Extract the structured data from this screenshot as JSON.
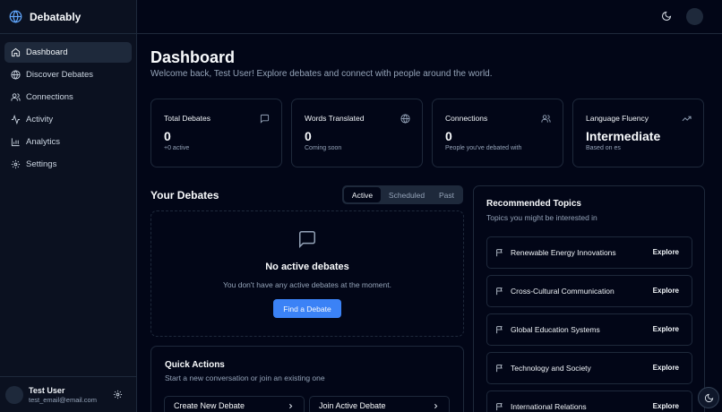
{
  "app": {
    "name": "Debatably"
  },
  "sidebar": {
    "items": [
      {
        "label": "Dashboard"
      },
      {
        "label": "Discover Debates"
      },
      {
        "label": "Connections"
      },
      {
        "label": "Activity"
      },
      {
        "label": "Analytics"
      },
      {
        "label": "Settings"
      }
    ],
    "active_item": "Dashboard"
  },
  "user": {
    "name": "Test User",
    "email": "test_email@email.com"
  },
  "header": {
    "title": "Dashboard",
    "subtitle": "Welcome back, Test User! Explore debates and connect with people around the world."
  },
  "stats": [
    {
      "title": "Total Debates",
      "value": "0",
      "note": "+0 active",
      "icon": "message-square-icon"
    },
    {
      "title": "Words Translated",
      "value": "0",
      "note": "Coming soon",
      "icon": "globe-icon"
    },
    {
      "title": "Connections",
      "value": "0",
      "note": "People you've debated with",
      "icon": "users-icon"
    },
    {
      "title": "Language Fluency",
      "value": "Intermediate",
      "note": "Based on es",
      "icon": "trending-up-icon"
    }
  ],
  "debates": {
    "title": "Your Debates",
    "tabs": [
      {
        "label": "Active"
      },
      {
        "label": "Scheduled"
      },
      {
        "label": "Past"
      }
    ],
    "active_tab": "Active",
    "empty_title": "No active debates",
    "empty_text": "You don't have any active debates at the moment.",
    "find_button": "Find a Debate"
  },
  "quick_actions": {
    "title": "Quick Actions",
    "subtitle": "Start a new conversation or join an existing one",
    "buttons": [
      {
        "label": "Create New Debate"
      },
      {
        "label": "Join Active Debate"
      }
    ]
  },
  "recommended": {
    "title": "Recommended Topics",
    "subtitle": "Topics you might be interested in",
    "topics": [
      {
        "label": "Renewable Energy Innovations",
        "action": "Explore"
      },
      {
        "label": "Cross-Cultural Communication",
        "action": "Explore"
      },
      {
        "label": "Global Education Systems",
        "action": "Explore"
      },
      {
        "label": "Technology and Society",
        "action": "Explore"
      },
      {
        "label": "International Relations",
        "action": "Explore"
      }
    ]
  },
  "colors": {
    "background": "#020617",
    "sidebar": "#0b1120",
    "border": "#1e293b",
    "accent": "#3b82f6",
    "muted_text": "#94a3b8"
  }
}
